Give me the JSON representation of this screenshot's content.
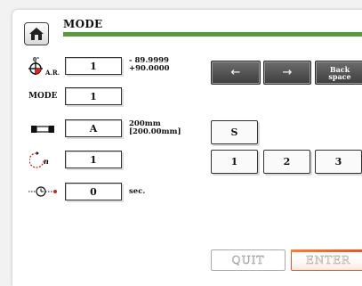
{
  "header": {
    "title": "MODE"
  },
  "rows": [
    {
      "icon": "angle-rotation-icon",
      "icon_label": "A.R.",
      "value": "1",
      "note": "- 89.9999\n+90.0000"
    },
    {
      "label": "MODE",
      "value": "1"
    },
    {
      "icon": "caliper-icon",
      "value": "A",
      "note": "200mm\n[200.00mm]"
    },
    {
      "icon": "rotate-count-icon",
      "icon_label": "n",
      "value": "1"
    },
    {
      "icon": "timer-icon",
      "value": "0",
      "note": "sec."
    }
  ],
  "keypad": {
    "left_arrow": "←",
    "right_arrow": "→",
    "backspace": "Back\nspace",
    "s_key": "S",
    "digits": [
      "1",
      "2",
      "3"
    ]
  },
  "footer": {
    "quit_label": "QUIT",
    "enter_label": "ENTER"
  },
  "colors": {
    "title_bar": "#5a9a3a",
    "enter_accent": "#e2552a"
  }
}
